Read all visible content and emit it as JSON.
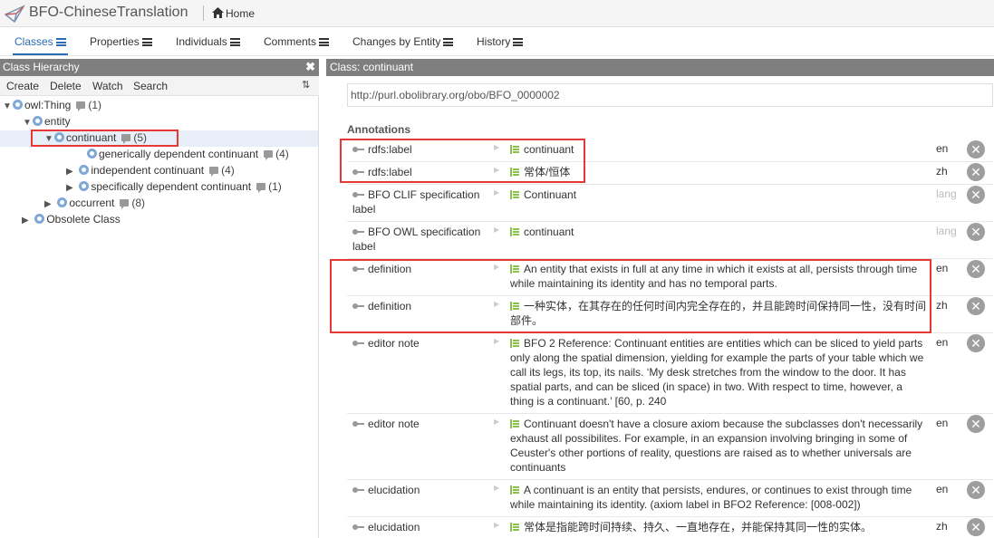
{
  "app": {
    "title": "BFO-ChineseTranslation",
    "home_label": "Home"
  },
  "nav": {
    "tabs": [
      "Classes",
      "Properties",
      "Individuals",
      "Comments",
      "Changes by Entity",
      "History"
    ]
  },
  "left": {
    "header": "Class Hierarchy",
    "close_glyph": "✖",
    "toolbar": [
      "Create",
      "Delete",
      "Watch",
      "Search"
    ],
    "filter_glyph": "⇅",
    "tree": [
      {
        "label": "owl:Thing",
        "count": "(1)"
      },
      {
        "label": "entity",
        "count": ""
      },
      {
        "label": "continuant",
        "count": "(5)"
      },
      {
        "label": "generically dependent continuant",
        "count": "(4)"
      },
      {
        "label": "independent continuant",
        "count": "(4)"
      },
      {
        "label": "specifically dependent continuant",
        "count": "(1)"
      },
      {
        "label": "occurrent",
        "count": "(8)"
      },
      {
        "label": "Obsolete Class",
        "count": ""
      }
    ]
  },
  "right": {
    "header": "Class: continuant",
    "iri": "http://purl.obolibrary.org/obo/BFO_0000002",
    "annotations_label": "Annotations",
    "annotations": [
      {
        "prop": "rdfs:label",
        "value": "continuant",
        "lang": "en"
      },
      {
        "prop": "rdfs:label",
        "value": "常体/恒体",
        "lang": "zh"
      },
      {
        "prop": "BFO CLIF specification label",
        "value": "Continuant",
        "lang": "lang"
      },
      {
        "prop": "BFO OWL specification label",
        "value": "continuant",
        "lang": "lang"
      },
      {
        "prop": "definition",
        "value": "An entity that exists in full at any time in which it exists at all, persists through time while maintaining its identity and has no temporal parts.",
        "lang": "en"
      },
      {
        "prop": "definition",
        "value": "一种实体，在其存在的任何时间内完全存在的，并且能跨时间保持同一性，没有时间部件。",
        "lang": "zh"
      },
      {
        "prop": "editor note",
        "value": "BFO 2 Reference: Continuant entities are entities which can be sliced to yield parts only along the spatial dimension, yielding for example the parts of your table which we call its legs, its top, its nails. ‘My desk stretches from the window to the door. It has spatial parts, and can be sliced (in space) in two. With respect to time, however, a thing is a continuant.’ [60, p. 240",
        "lang": "en"
      },
      {
        "prop": "editor note",
        "value": "Continuant doesn't have a closure axiom because the subclasses don't necessarily exhaust all possibilites. For example, in an expansion involving bringing in some of Ceuster's other portions of reality, questions are raised as to whether universals are continuants",
        "lang": "en"
      },
      {
        "prop": "elucidation",
        "value": "A continuant is an entity that persists, endures, or continues to exist through time while maintaining its identity. (axiom label in BFO2 Reference: [008-002])",
        "lang": "en"
      },
      {
        "prop": "elucidation",
        "value": "常体是指能跨时间持续、持久、一直地存在，并能保持其同一性的实体。",
        "lang": "zh"
      }
    ]
  }
}
